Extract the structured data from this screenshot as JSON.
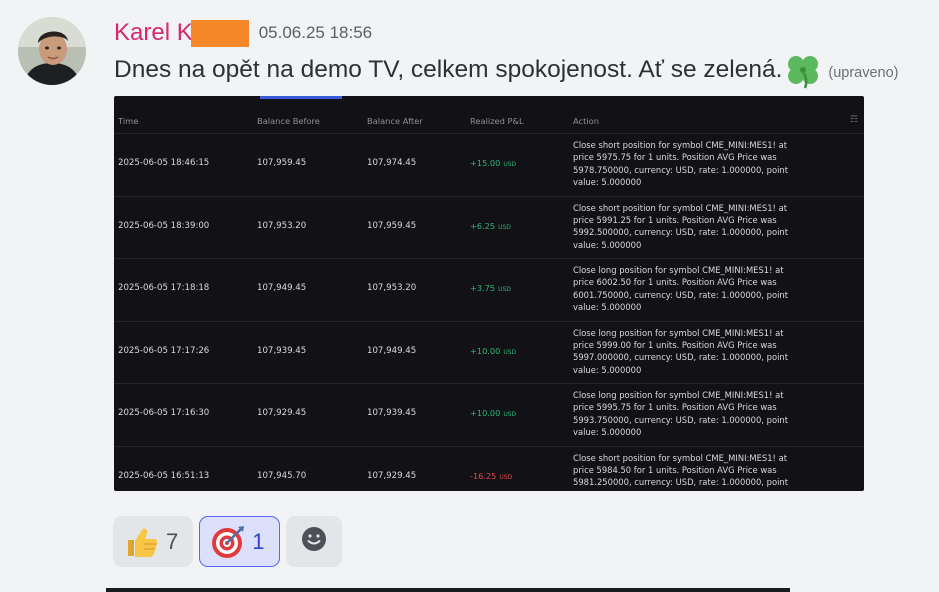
{
  "message": {
    "author": "Karel K",
    "timestamp": "05.06.25 18:56",
    "text": "Dnes na opět na demo TV, celkem spokojenost. Ať se zelená.",
    "emoji": "four-leaf-clover",
    "edited": "(upraveno)"
  },
  "table": {
    "headers": [
      "Time",
      "Balance Before",
      "Balance After",
      "Realized P&L",
      "Action"
    ],
    "rows": [
      {
        "time": "2025-06-05 18:46:15",
        "before": "107,959.45",
        "after": "107,974.45",
        "pnl": "+15.00",
        "currency": "USD",
        "sign": "pos",
        "action": [
          "Close short position for symbol CME_MINI:MES1! at",
          "price 5975.75 for 1 units. Position AVG Price was",
          "5978.750000, currency: USD, rate: 1.000000, point",
          "value: 5.000000"
        ]
      },
      {
        "time": "2025-06-05 18:39:00",
        "before": "107,953.20",
        "after": "107,959.45",
        "pnl": "+6.25",
        "currency": "USD",
        "sign": "pos",
        "action": [
          "Close short position for symbol CME_MINI:MES1! at",
          "price 5991.25 for 1 units. Position AVG Price was",
          "5992.500000, currency: USD, rate: 1.000000, point",
          "value: 5.000000"
        ]
      },
      {
        "time": "2025-06-05 17:18:18",
        "before": "107,949.45",
        "after": "107,953.20",
        "pnl": "+3.75",
        "currency": "USD",
        "sign": "pos",
        "action": [
          "Close long position for symbol CME_MINI:MES1! at",
          "price 6002.50 for 1 units. Position AVG Price was",
          "6001.750000, currency: USD, rate: 1.000000, point",
          "value: 5.000000"
        ]
      },
      {
        "time": "2025-06-05 17:17:26",
        "before": "107,939.45",
        "after": "107,949.45",
        "pnl": "+10.00",
        "currency": "USD",
        "sign": "pos",
        "action": [
          "Close long position for symbol CME_MINI:MES1! at",
          "price 5999.00 for 1 units. Position AVG Price was",
          "5997.000000, currency: USD, rate: 1.000000, point",
          "value: 5.000000"
        ]
      },
      {
        "time": "2025-06-05 17:16:30",
        "before": "107,929.45",
        "after": "107,939.45",
        "pnl": "+10.00",
        "currency": "USD",
        "sign": "pos",
        "action": [
          "Close long position for symbol CME_MINI:MES1! at",
          "price 5995.75 for 1 units. Position AVG Price was",
          "5993.750000, currency: USD, rate: 1.000000, point",
          "value: 5.000000"
        ]
      },
      {
        "time": "2025-06-05 16:51:13",
        "before": "107,945.70",
        "after": "107,929.45",
        "pnl": "-16.25",
        "currency": "USD",
        "sign": "neg",
        "action": [
          "Close short position for symbol CME_MINI:MES1! at",
          "price 5984.50 for 1 units. Position AVG Price was",
          "5981.250000, currency: USD, rate: 1.000000, point",
          "value: 5.000000"
        ]
      }
    ]
  },
  "reactions": [
    {
      "emoji": "thumbs-up",
      "count": "7",
      "active": false
    },
    {
      "emoji": "direct-hit",
      "count": "1",
      "active": true
    }
  ],
  "colors": {
    "author": "#d6286e",
    "positive": "#2bb673",
    "negative": "#e5484d",
    "accent": "#5865f2",
    "redaction": "#f7882a"
  }
}
